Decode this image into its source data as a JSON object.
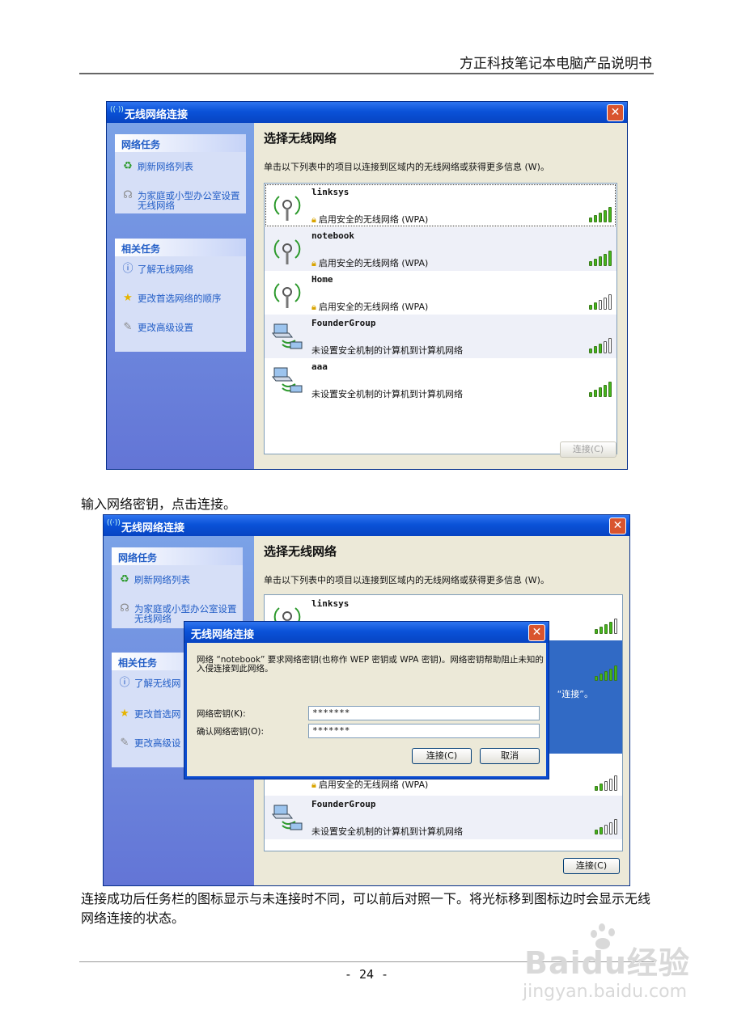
{
  "header": {
    "title": "方正科技笔记本电脑产品说明书"
  },
  "window": {
    "title": "无线网络连接",
    "close_glyph": "✕",
    "network_tasks": {
      "heading": "网络任务",
      "refresh": "刷新网络列表",
      "setup": "为家庭或小型办公室设置无线网络"
    },
    "related_tasks": {
      "heading": "相关任务",
      "learn": "了解无线网络",
      "order": "更改首选网络的顺序",
      "advanced": "更改高级设置"
    },
    "main_title": "选择无线网络",
    "description": "单击以下列表中的项目以连接到区域内的无线网络或获得更多信息 (W)。",
    "connect_button": "连接(C)",
    "networks": [
      {
        "name": "linksys",
        "security": "启用安全的无线网络 (WPA)",
        "type": "ap",
        "signal": 5
      },
      {
        "name": "notebook",
        "security": "启用安全的无线网络 (WPA)",
        "type": "ap",
        "signal": 5
      },
      {
        "name": "Home",
        "security": "启用安全的无线网络 (WPA)",
        "type": "ap",
        "signal": 2
      },
      {
        "name": "FounderGroup",
        "security": "未设置安全机制的计算机到计算机网络",
        "type": "adhoc",
        "signal": 3
      },
      {
        "name": "aaa",
        "security": "未设置安全机制的计算机到计算机网络",
        "type": "adhoc",
        "signal": 5
      }
    ]
  },
  "instruction": "输入网络密钥，点击连接。",
  "window2": {
    "visible_networks": [
      {
        "name": "linksys",
        "signal": 4
      },
      {
        "name": "",
        "security": "启用安全的无线网络 (WPA)",
        "signal": 2
      },
      {
        "name": "FounderGroup",
        "security": "未设置安全机制的计算机到计算机网络",
        "signal": 2
      }
    ],
    "selected_fragment": "“连接”。",
    "partial_learn": "了解无线网",
    "partial_order": "更改首选网",
    "partial_advanced": "更改高级设"
  },
  "key_dialog": {
    "title": "无线网络连接",
    "message": "网络 “notebook” 要求网络密钥(也称作 WEP 密钥或 WPA 密钥)。网络密钥帮助阻止未知的入侵连接到此网络。",
    "key_label": "网络密钥(K):",
    "key_value": "*******",
    "confirm_label": "确认网络密钥(O):",
    "confirm_value": "*******",
    "connect_button": "连接(C)",
    "cancel_button": "取消"
  },
  "paragraph": "连接成功后任务栏的图标显示与未连接时不同，可以前后对照一下。将光标移到图标边时会显示无线网络连接的状态。",
  "page_number": "- 24 -",
  "watermark": {
    "logo": "Baidu经验",
    "url": "jingyan.baidu.com"
  },
  "colors": {
    "xp_title_blue": "#0b4bd0",
    "link_blue": "#215dc6",
    "signal_green": "#44b81b"
  }
}
